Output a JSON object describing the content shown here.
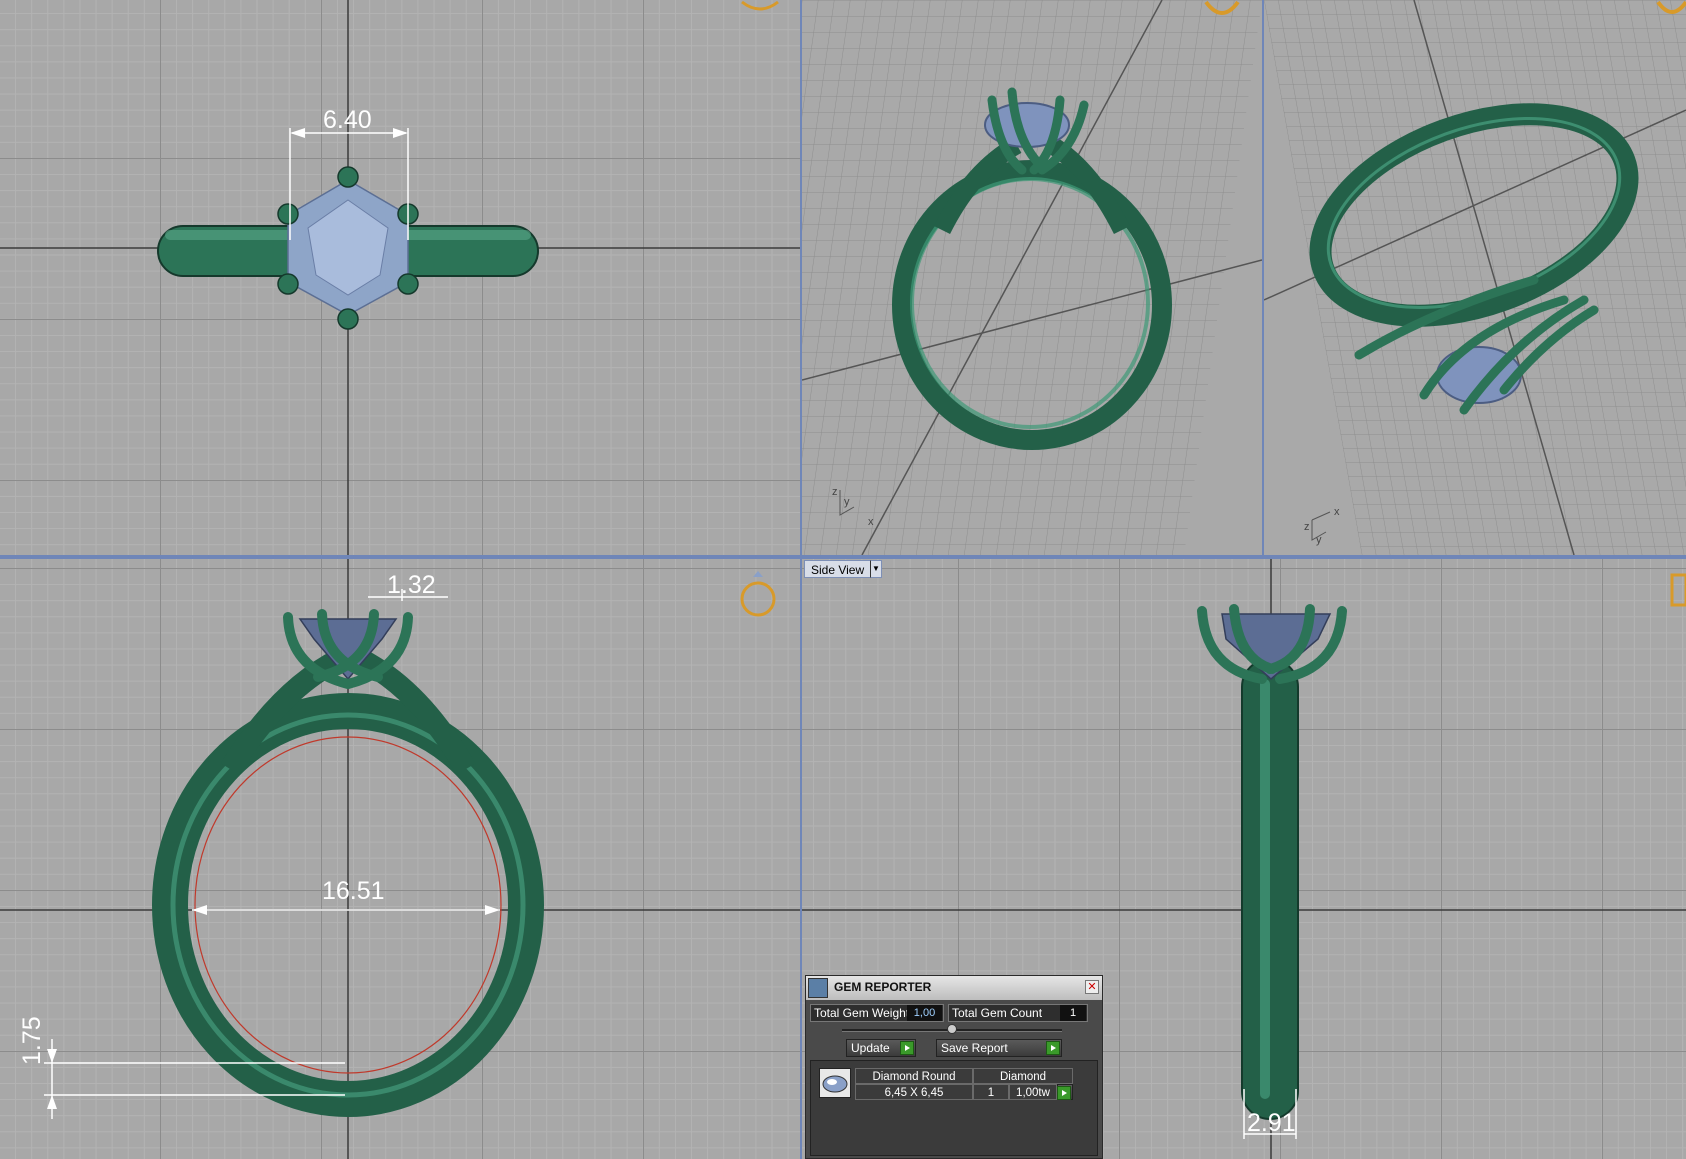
{
  "viewports": {
    "top": {
      "dimension": "6.40"
    },
    "front": {
      "dimension_top": "1.32",
      "dimension_inner": "16.51",
      "dimension_bottom": "1.75"
    },
    "side": {
      "label": "Side View",
      "dimension": "2.91"
    },
    "perspective": {
      "axis_z": "z",
      "axis_y": "y",
      "axis_x": "x"
    },
    "perspective2": {
      "axis_z": "z",
      "axis_y": "y",
      "axis_x": "x"
    }
  },
  "gem_reporter": {
    "title": "GEM REPORTER",
    "total_weight_label": "Total Gem Weight",
    "total_weight_value": "1,00",
    "total_count_label": "Total Gem Count",
    "total_count_value": "1",
    "update_label": "Update",
    "save_report_label": "Save Report",
    "row": {
      "shape": "Diamond Round",
      "material": "Diamond",
      "size": "6,45 X 6,45",
      "count": "1",
      "weight": "1,00tw"
    }
  },
  "colors": {
    "metal": "#2e7a5e",
    "gem": "#8aa0c8",
    "accent": "#d89a2a",
    "viewport_bg": "#a8a8a8"
  }
}
